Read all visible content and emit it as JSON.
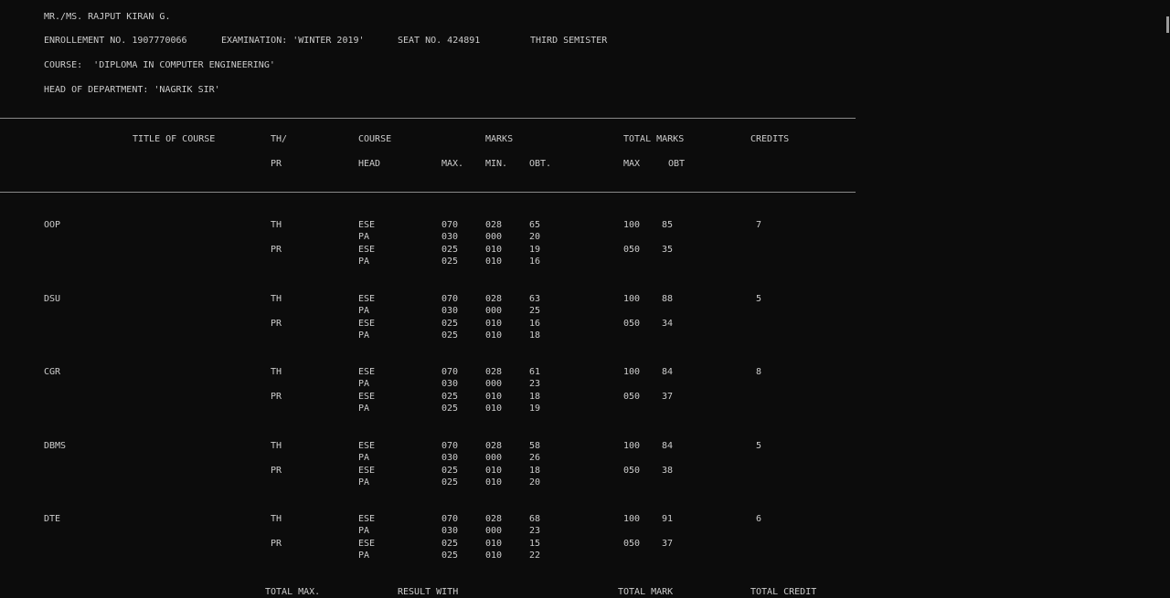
{
  "header": {
    "name_line": "MR./MS. RAJPUT KIRAN G.",
    "enrollment": "ENROLLEMENT NO. 1907770066",
    "examination": "EXAMINATION: 'WINTER 2019'",
    "seat": "SEAT NO. 424891",
    "semester": "THIRD SEMISTER",
    "course": "COURSE:  'DIPLOMA IN COMPUTER ENGINEERING'",
    "hod": "HEAD OF DEPARTMENT: 'NAGRIK SIR'"
  },
  "columns": {
    "title": "TITLE OF COURSE",
    "thpr_1": "TH/",
    "thpr_2": "PR",
    "course_head_1": "COURSE",
    "course_head_2": "HEAD",
    "marks": "MARKS",
    "max": "MAX.",
    "min": "MIN.",
    "obt": "OBT.",
    "total_marks": "TOTAL MARKS",
    "total_max": "MAX",
    "total_obt": "OBT",
    "credits": "CREDITS"
  },
  "subjects": [
    {
      "name": "OOP",
      "credits": "7",
      "th": {
        "type": "TH",
        "total_max": "100",
        "total_obt": "85",
        "ese": [
          "ESE",
          "070",
          "028",
          "65"
        ],
        "pa": [
          "PA",
          "030",
          "000",
          "20"
        ]
      },
      "pr": {
        "type": "PR",
        "total_max": "050",
        "total_obt": "35",
        "ese": [
          "ESE",
          "025",
          "010",
          "19"
        ],
        "pa": [
          "PA",
          "025",
          "010",
          "16"
        ]
      }
    },
    {
      "name": "DSU",
      "credits": "5",
      "th": {
        "type": "TH",
        "total_max": "100",
        "total_obt": "88",
        "ese": [
          "ESE",
          "070",
          "028",
          "63"
        ],
        "pa": [
          "PA",
          "030",
          "000",
          "25"
        ]
      },
      "pr": {
        "type": "PR",
        "total_max": "050",
        "total_obt": "34",
        "ese": [
          "ESE",
          "025",
          "010",
          "16"
        ],
        "pa": [
          "PA",
          "025",
          "010",
          "18"
        ]
      }
    },
    {
      "name": "CGR",
      "credits": "8",
      "th": {
        "type": "TH",
        "total_max": "100",
        "total_obt": "84",
        "ese": [
          "ESE",
          "070",
          "028",
          "61"
        ],
        "pa": [
          "PA",
          "030",
          "000",
          "23"
        ]
      },
      "pr": {
        "type": "PR",
        "total_max": "050",
        "total_obt": "37",
        "ese": [
          "ESE",
          "025",
          "010",
          "18"
        ],
        "pa": [
          "PA",
          "025",
          "010",
          "19"
        ]
      }
    },
    {
      "name": "DBMS",
      "credits": "5",
      "th": {
        "type": "TH",
        "total_max": "100",
        "total_obt": "84",
        "ese": [
          "ESE",
          "070",
          "028",
          "58"
        ],
        "pa": [
          "PA",
          "030",
          "000",
          "26"
        ]
      },
      "pr": {
        "type": "PR",
        "total_max": "050",
        "total_obt": "38",
        "ese": [
          "ESE",
          "025",
          "010",
          "18"
        ],
        "pa": [
          "PA",
          "025",
          "010",
          "20"
        ]
      }
    },
    {
      "name": "DTE",
      "credits": "6",
      "th": {
        "type": "TH",
        "total_max": "100",
        "total_obt": "91",
        "ese": [
          "ESE",
          "070",
          "028",
          "68"
        ],
        "pa": [
          "PA",
          "030",
          "000",
          "23"
        ]
      },
      "pr": {
        "type": "PR",
        "total_max": "050",
        "total_obt": "37",
        "ese": [
          "ESE",
          "025",
          "010",
          "15"
        ],
        "pa": [
          "PA",
          "025",
          "010",
          "22"
        ]
      }
    }
  ],
  "footer": {
    "total_max": "TOTAL MAX.",
    "result_with": "RESULT WITH",
    "total_mark": "TOTAL MARK",
    "total_credit": "TOTAL CREDIT"
  }
}
